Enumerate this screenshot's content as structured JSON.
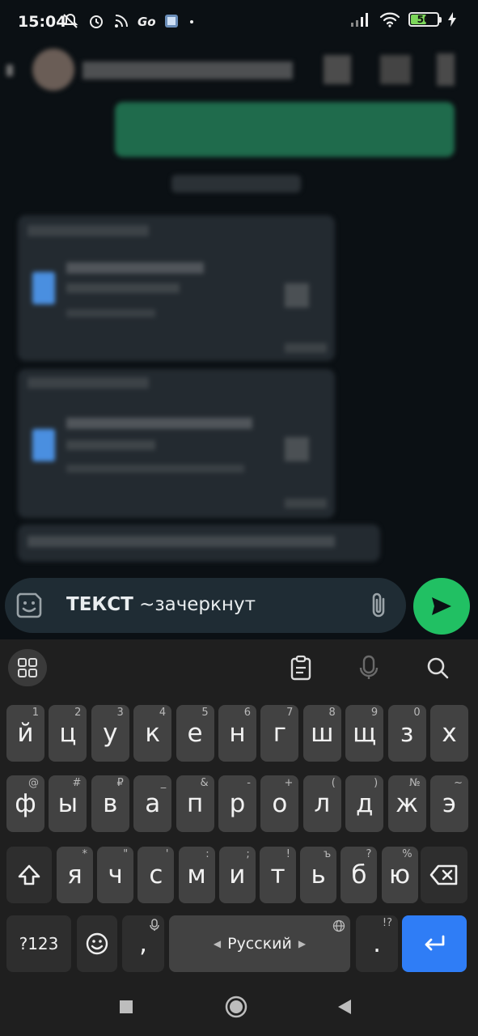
{
  "status_bar": {
    "time": "15:04",
    "battery_level": "50",
    "icons": [
      "mute-icon",
      "alarm-icon",
      "rss-icon",
      "app-go-icon",
      "gallery-icon",
      "dot-icon",
      "signal-icon",
      "wifi-icon",
      "battery-icon",
      "charging-icon"
    ]
  },
  "composer": {
    "bold_text": "ТЕКСТ",
    "strike_text": "~зачеркнут",
    "icons": [
      "sticker-icon",
      "attach-icon",
      "send-icon"
    ]
  },
  "keyboard": {
    "toolbar_icons": [
      "apps-grid-icon",
      "clipboard-icon",
      "mic-icon",
      "search-icon"
    ],
    "row1": [
      {
        "label": "й",
        "hint": "1"
      },
      {
        "label": "ц",
        "hint": "2"
      },
      {
        "label": "у",
        "hint": "3"
      },
      {
        "label": "к",
        "hint": "4"
      },
      {
        "label": "е",
        "hint": "5"
      },
      {
        "label": "н",
        "hint": "6"
      },
      {
        "label": "г",
        "hint": "7"
      },
      {
        "label": "ш",
        "hint": "8"
      },
      {
        "label": "щ",
        "hint": "9"
      },
      {
        "label": "з",
        "hint": "0"
      },
      {
        "label": "х",
        "hint": ""
      }
    ],
    "row2": [
      {
        "label": "ф",
        "hint": "@"
      },
      {
        "label": "ы",
        "hint": "#"
      },
      {
        "label": "в",
        "hint": "₽"
      },
      {
        "label": "а",
        "hint": "_"
      },
      {
        "label": "п",
        "hint": "&"
      },
      {
        "label": "р",
        "hint": "-"
      },
      {
        "label": "о",
        "hint": "+"
      },
      {
        "label": "л",
        "hint": "("
      },
      {
        "label": "д",
        "hint": ")"
      },
      {
        "label": "ж",
        "hint": "№"
      },
      {
        "label": "э",
        "hint": "~"
      }
    ],
    "row3": [
      {
        "label": "я",
        "hint": "*"
      },
      {
        "label": "ч",
        "hint": "\""
      },
      {
        "label": "с",
        "hint": "'"
      },
      {
        "label": "м",
        "hint": ":"
      },
      {
        "label": "и",
        "hint": ";"
      },
      {
        "label": "т",
        "hint": "!"
      },
      {
        "label": "ь",
        "hint": "ъ"
      },
      {
        "label": "б",
        "hint": "?"
      },
      {
        "label": "ю",
        "hint": "%"
      }
    ],
    "symbols_label": "?123",
    "comma_label": ",",
    "space_label": "Русский",
    "period_label": ".",
    "period_hint": "!?"
  },
  "nav_bar": {
    "icons": [
      "recents-square-icon",
      "home-circle-icon",
      "back-triangle-icon"
    ]
  }
}
